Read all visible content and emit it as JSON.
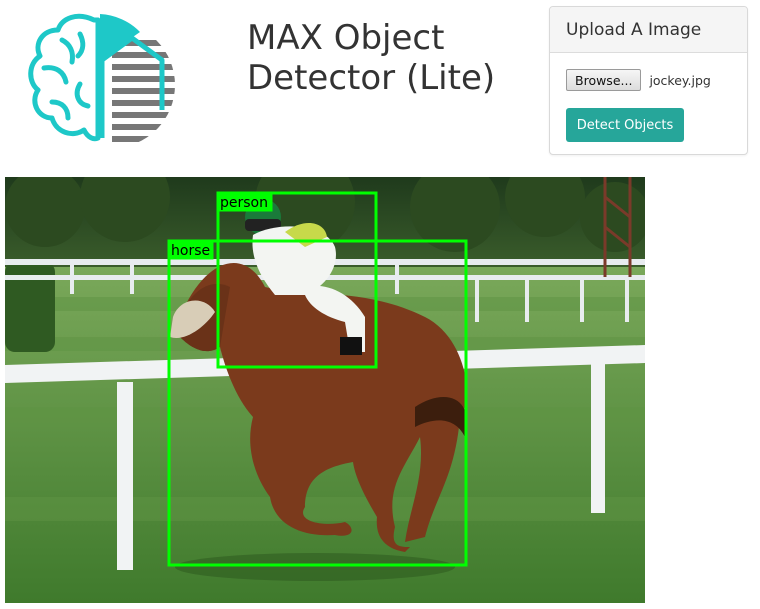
{
  "header": {
    "title_line1": "MAX Object",
    "title_line2": "Detector (Lite)"
  },
  "upload_panel": {
    "heading": "Upload A Image",
    "browse_label": "Browse...",
    "file_name": "jockey.jpg",
    "detect_label": "Detect Objects"
  },
  "colors": {
    "brand_teal": "#26a69a",
    "logo_teal": "#1ec8c8",
    "box_green": "#00ff00"
  },
  "detections": [
    {
      "label": "person"
    },
    {
      "label": "horse"
    }
  ]
}
